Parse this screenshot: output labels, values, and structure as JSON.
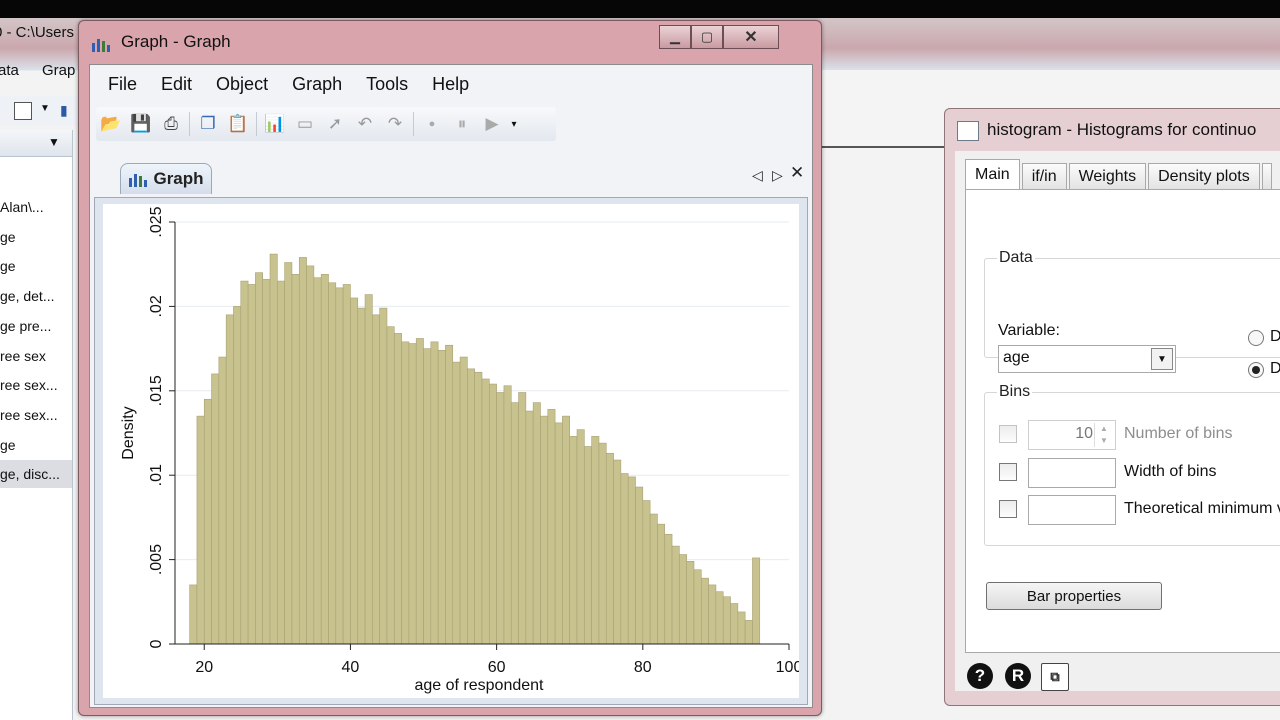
{
  "background_app": {
    "title": "0 - C:\\Users",
    "menu": [
      "ata",
      "Grap"
    ],
    "variables": [
      "Alan\\...",
      "ge",
      "ge",
      "ge, det...",
      "ge pre...",
      "ree sex",
      "ree sex...",
      "ree sex...",
      "ge",
      "ge, disc..."
    ],
    "selected_index": 9
  },
  "graph_window": {
    "title": "Graph - Graph",
    "menu": [
      "File",
      "Edit",
      "Object",
      "Graph",
      "Tools",
      "Help"
    ],
    "tab_label": "Graph",
    "toolbar_icons": [
      "open-icon",
      "save-icon",
      "print-icon",
      "copy-icon",
      "paste-icon",
      "graph-editor-icon",
      "blank-icon",
      "pointer-icon",
      "undo-icon",
      "redo-icon",
      "record-icon",
      "pause-icon",
      "play-icon",
      "overflow-icon"
    ],
    "window_buttons": [
      "minimize-icon",
      "maximize-icon",
      "close-icon"
    ]
  },
  "chart_data": {
    "type": "bar",
    "xlabel": "age of respondent",
    "ylabel": "Density",
    "xlim": [
      16,
      100
    ],
    "ylim": [
      0,
      0.025
    ],
    "xticks": [
      "20",
      "40",
      "60",
      "80",
      "100"
    ],
    "yticks": [
      "0",
      ".005",
      ".01",
      ".015",
      ".02",
      ".025"
    ],
    "bar_color": "#c8c28f",
    "bar_edge_color": "#a8a274",
    "grid": true,
    "x_start": 18,
    "bin_width": 1,
    "values": [
      0.0035,
      0.0135,
      0.0145,
      0.016,
      0.017,
      0.0195,
      0.02,
      0.0215,
      0.0213,
      0.022,
      0.0216,
      0.0231,
      0.0215,
      0.0226,
      0.0219,
      0.0229,
      0.0224,
      0.0217,
      0.0219,
      0.0214,
      0.0211,
      0.0213,
      0.0205,
      0.0199,
      0.0207,
      0.0195,
      0.0199,
      0.0188,
      0.0184,
      0.0179,
      0.0178,
      0.0181,
      0.0175,
      0.0179,
      0.0174,
      0.0177,
      0.0167,
      0.017,
      0.0163,
      0.0161,
      0.0157,
      0.0154,
      0.0149,
      0.0153,
      0.0143,
      0.0149,
      0.0138,
      0.0143,
      0.0135,
      0.0139,
      0.0131,
      0.0135,
      0.0123,
      0.0127,
      0.0117,
      0.0123,
      0.0119,
      0.0113,
      0.0109,
      0.0101,
      0.0099,
      0.0093,
      0.0085,
      0.0077,
      0.0071,
      0.0065,
      0.0058,
      0.0053,
      0.0049,
      0.0044,
      0.0039,
      0.0035,
      0.0031,
      0.0028,
      0.0024,
      0.0019,
      0.0014,
      0.0051
    ]
  },
  "dialog": {
    "title": "histogram - Histograms for continuo",
    "tabs": [
      "Main",
      "if/in",
      "Weights",
      "Density plots",
      ""
    ],
    "data_group": "Data",
    "variable_label": "Variable:",
    "variable_value": "age",
    "radio_labels": [
      "Da",
      "Da"
    ],
    "radio_selected": 1,
    "bins_group": "Bins",
    "bins": [
      {
        "label": "Number of bins",
        "value": "10",
        "enabled": false
      },
      {
        "label": "Width of bins",
        "value": "",
        "enabled": true
      },
      {
        "label": "Theoretical minimum v",
        "value": "",
        "enabled": true
      }
    ],
    "bar_properties_button": "Bar properties",
    "footer_icons": [
      "help-icon",
      "reset-icon",
      "copy-command-icon"
    ]
  }
}
